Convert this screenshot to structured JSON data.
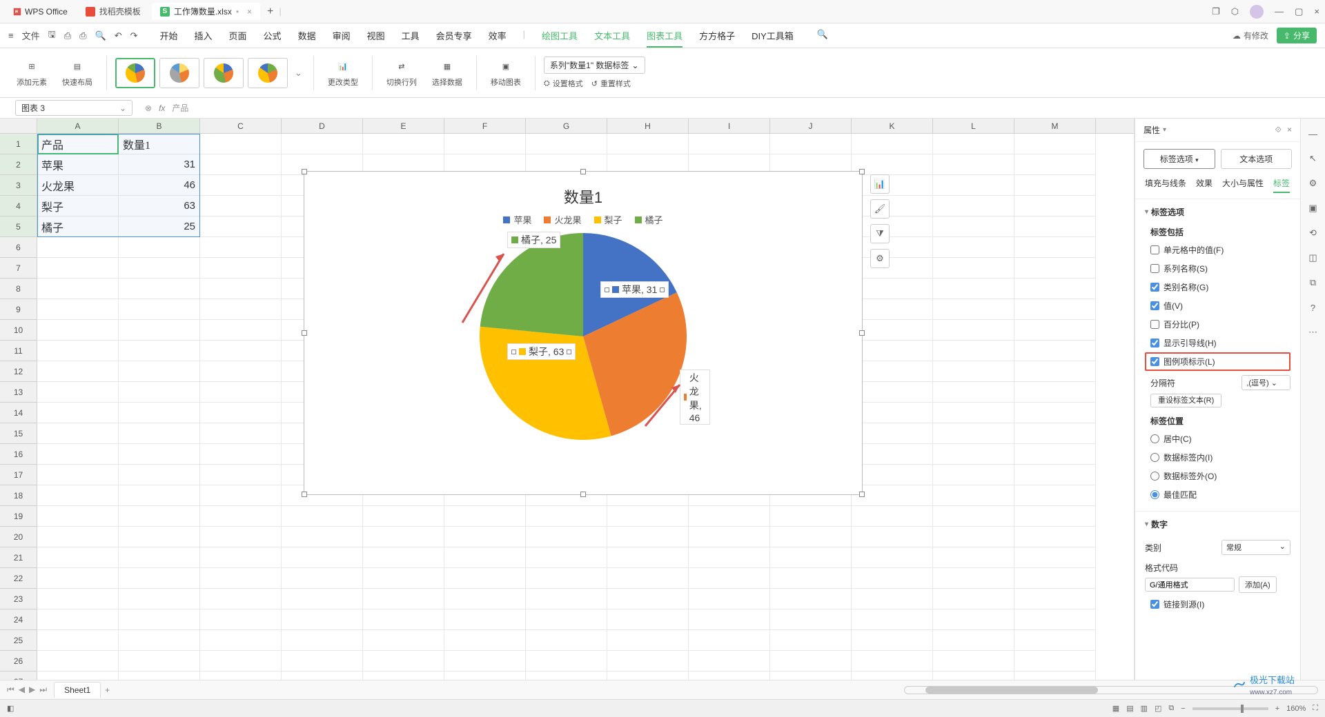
{
  "title_bar": {
    "wps": "WPS Office",
    "tab_stencil": "找稻壳模板",
    "tab_active": "工作簿数量.xlsx"
  },
  "menu": {
    "file": "文件",
    "items": [
      "开始",
      "插入",
      "页面",
      "公式",
      "数据",
      "审阅",
      "视图",
      "工具",
      "会员专享",
      "效率"
    ],
    "green_items": [
      "绘图工具",
      "文本工具",
      "图表工具",
      "方方格子",
      "DIY工具箱"
    ],
    "active": "图表工具",
    "modify": "有修改",
    "share": "分享"
  },
  "ribbon": {
    "add_element": "添加元素",
    "quick_layout": "快速布局",
    "change_type": "更改类型",
    "swap_rc": "切换行列",
    "select_data": "选择数据",
    "move_chart": "移动图表",
    "series_label": "系列\"数量1\" 数据标签",
    "set_format": "设置格式",
    "reset_style": "重置样式"
  },
  "formula": {
    "name_box": "图表 3",
    "text": "产品"
  },
  "columns": [
    "A",
    "B",
    "C",
    "D",
    "E",
    "F",
    "G",
    "H",
    "I",
    "J",
    "K",
    "L",
    "M"
  ],
  "rows": [
    {
      "n": "1",
      "a": "产品",
      "b": "数量1"
    },
    {
      "n": "2",
      "a": "苹果",
      "b": "31"
    },
    {
      "n": "3",
      "a": "火龙果",
      "b": "46"
    },
    {
      "n": "4",
      "a": "梨子",
      "b": "63"
    },
    {
      "n": "5",
      "a": "橘子",
      "b": "25"
    }
  ],
  "chart_data": {
    "type": "pie",
    "title": "数量1",
    "categories": [
      "苹果",
      "火龙果",
      "梨子",
      "橘子"
    ],
    "values": [
      31,
      46,
      63,
      25
    ],
    "colors": [
      "#4472c4",
      "#ed7d31",
      "#ffc000",
      "#70ad47"
    ],
    "labels": [
      "苹果, 31",
      "火龙果, 46",
      "梨子, 63",
      "橘子, 25"
    ],
    "legend_position": "top",
    "data_label_format": "legend_key, category, value"
  },
  "panel": {
    "header": "属性",
    "tab_label": "标签选项",
    "tab_text": "文本选项",
    "subtabs": [
      "填充与线条",
      "效果",
      "大小与属性",
      "标签"
    ],
    "subtab_active": "标签",
    "sec_label_opts": "标签选项",
    "label_includes": "标签包括",
    "chk_cell_val": "单元格中的值(F)",
    "chk_series": "系列名称(S)",
    "chk_category": "类别名称(G)",
    "chk_value": "值(V)",
    "chk_percent": "百分比(P)",
    "chk_leader": "显示引导线(H)",
    "chk_legend_key": "图例项标示(L)",
    "separator": "分隔符",
    "sep_opt": ",(逗号)",
    "reset_text": "重设标签文本(R)",
    "sec_pos": "标签位置",
    "pos_center": "居中(C)",
    "pos_inside": "数据标签内(I)",
    "pos_outside": "数据标签外(O)",
    "pos_best": "最佳匹配",
    "sec_num": "数字",
    "category_lbl": "类别",
    "category_val": "常规",
    "format_code_lbl": "格式代码",
    "format_code_val": "G/通用格式",
    "add_btn": "添加(A)",
    "chk_link_src": "链接到源(I)"
  },
  "sheet_tabs": {
    "sheet1": "Sheet1"
  },
  "status": {
    "zoom": "160%",
    "watermark": "极光下载站",
    "watermark_url": "www.xz7.com"
  }
}
